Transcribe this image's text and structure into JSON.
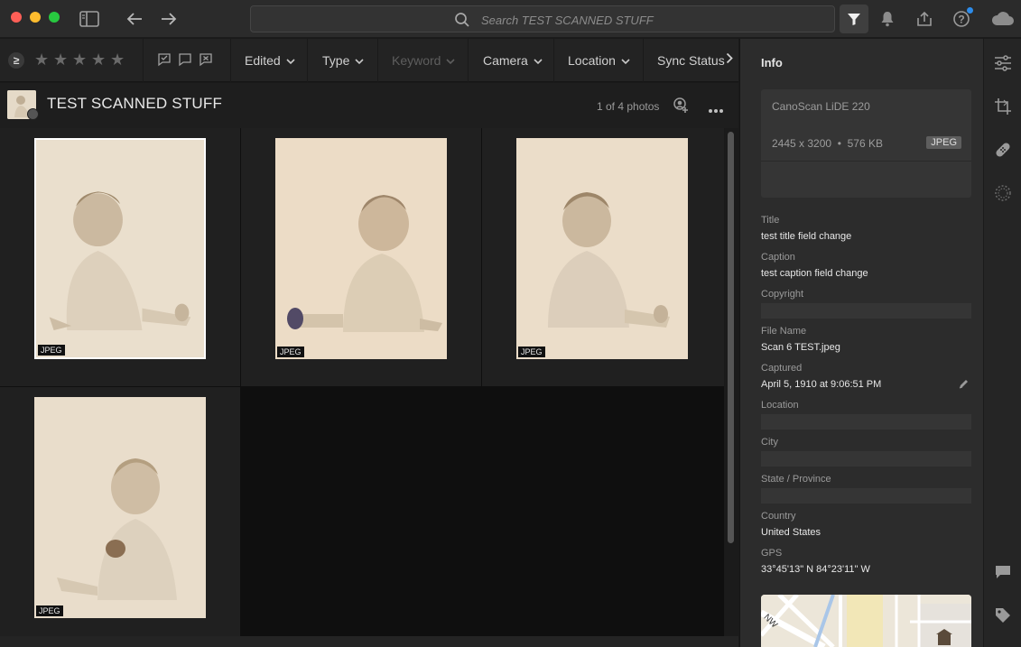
{
  "search": {
    "placeholder": "Search TEST SCANNED STUFF"
  },
  "filters": {
    "ge_label": "≥",
    "items": [
      {
        "label": "Edited",
        "enabled": true
      },
      {
        "label": "Type",
        "enabled": true
      },
      {
        "label": "Keyword",
        "enabled": false
      },
      {
        "label": "Camera",
        "enabled": true
      },
      {
        "label": "Location",
        "enabled": true
      },
      {
        "label": "Sync Status",
        "enabled": true
      }
    ]
  },
  "album": {
    "title": "TEST SCANNED STUFF",
    "count": "1 of 4 photos",
    "photos": [
      {
        "type": "JPEG",
        "selected": true
      },
      {
        "type": "JPEG",
        "selected": false
      },
      {
        "type": "JPEG",
        "selected": false
      },
      {
        "type": "JPEG",
        "selected": false
      }
    ]
  },
  "info": {
    "heading": "Info",
    "camera": "CanoScan LiDE 220",
    "dimensions": "2445 x 3200",
    "size": "576 KB",
    "type": "JPEG",
    "fields": {
      "title_label": "Title",
      "title_value": "test title field change",
      "caption_label": "Caption",
      "caption_value": "test caption field change",
      "copyright_label": "Copyright",
      "filename_label": "File Name",
      "filename_value": "Scan 6 TEST.jpeg",
      "captured_label": "Captured",
      "captured_value": "April 5, 1910 at 9:06:51 PM",
      "location_label": "Location",
      "city_label": "City",
      "state_label": "State / Province",
      "country_label": "Country",
      "country_value": "United States",
      "gps_label": "GPS",
      "gps_value": "33°45'13\" N 84°23'11\" W"
    },
    "map_label": "NW"
  },
  "colors": {
    "accent": "#2d8ceb",
    "panel": "#2c2c2c",
    "photo_tone": "#e8dccb"
  }
}
